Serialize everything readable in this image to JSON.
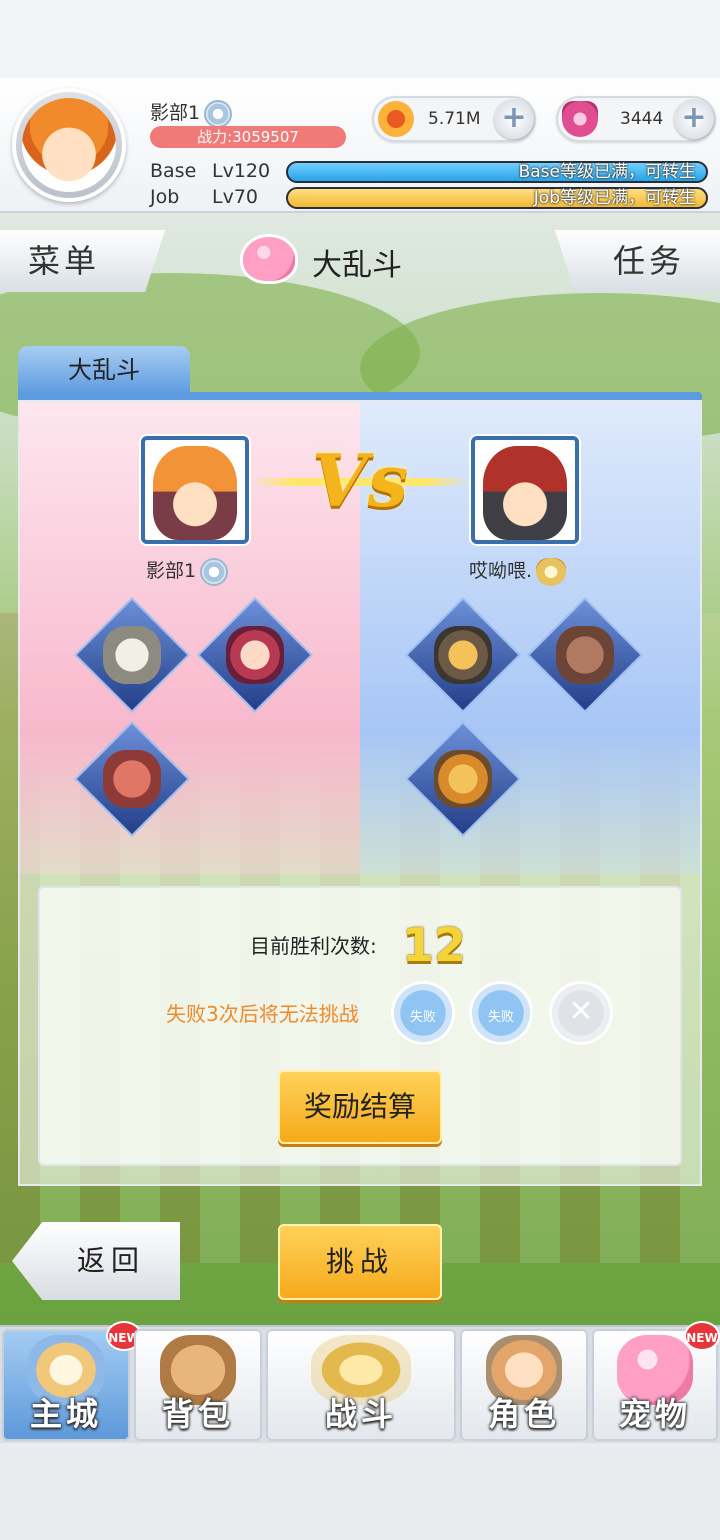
{
  "header": {
    "player_name": "影部1",
    "power_label": "战力:3059507",
    "coins": "5.71M",
    "gems": "3444",
    "plus_symbol": "+",
    "base_label": "Base",
    "base_level": "Lv120",
    "base_status": "Base等级已满，可转生",
    "job_label": "Job",
    "job_level": "Lv70",
    "job_status": "Job等级已满，可转生"
  },
  "nav": {
    "menu": "菜单",
    "title": "大乱斗",
    "tasks": "任务"
  },
  "panel": {
    "tab_label": "大乱斗",
    "vs_text": "Vs",
    "player": {
      "name": "影部1"
    },
    "opponent": {
      "name": "哎呦喂."
    },
    "player_pets": [
      "skeleton-pet",
      "demon-girl-pet",
      "worm-pet"
    ],
    "opponent_pets": [
      "bee-soldier-pet",
      "werewolf-pet",
      "hornet-pet"
    ]
  },
  "result": {
    "wins_label": "目前胜利次数:",
    "wins_value": "12",
    "warning": "失败3次后将无法挑战",
    "loss_marks": [
      {
        "label": "失败",
        "state": "lost"
      },
      {
        "label": "失败",
        "state": "lost"
      },
      {
        "label": "✕",
        "state": "empty"
      }
    ],
    "reward_button": "奖励结算"
  },
  "actions": {
    "back": "返回",
    "challenge": "挑战"
  },
  "tabbar": [
    {
      "label": "主城",
      "icon": "castle-icon",
      "new": "NEW",
      "active": true
    },
    {
      "label": "背包",
      "icon": "backpack-icon",
      "new": "",
      "active": false
    },
    {
      "label": "战斗",
      "icon": "crossed-swords-icon",
      "new": "",
      "active": false
    },
    {
      "label": "角色",
      "icon": "character-icon",
      "new": "",
      "active": false
    },
    {
      "label": "宠物",
      "icon": "poring-pet-icon",
      "new": "NEW",
      "active": false
    }
  ],
  "colors": {
    "accent_blue": "#5d9be0",
    "button_gold": "#f5a91a",
    "warning_orange": "#ef8a2a",
    "power_bar": "#ef7a78"
  }
}
